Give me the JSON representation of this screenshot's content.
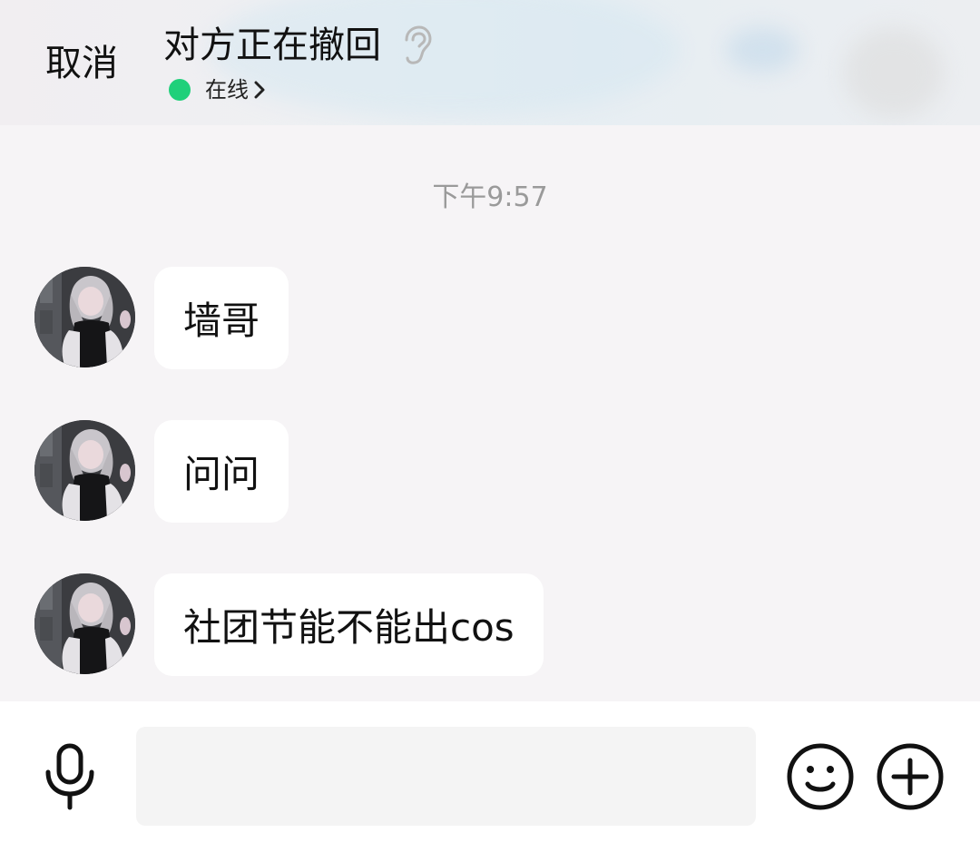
{
  "header": {
    "cancel_label": "取消",
    "title": "对方正在撤回",
    "title_icon": "ear-icon",
    "status_text": "在线",
    "status_color": "#1fd07a"
  },
  "chat": {
    "timestamp": "下午9:57",
    "messages": [
      {
        "text": "墙哥"
      },
      {
        "text": "问问"
      },
      {
        "text": "社团节能不能出cos"
      }
    ]
  },
  "input_bar": {
    "input_value": "",
    "input_placeholder": "",
    "icons": [
      "microphone-icon",
      "emoji-icon",
      "plus-icon"
    ]
  }
}
